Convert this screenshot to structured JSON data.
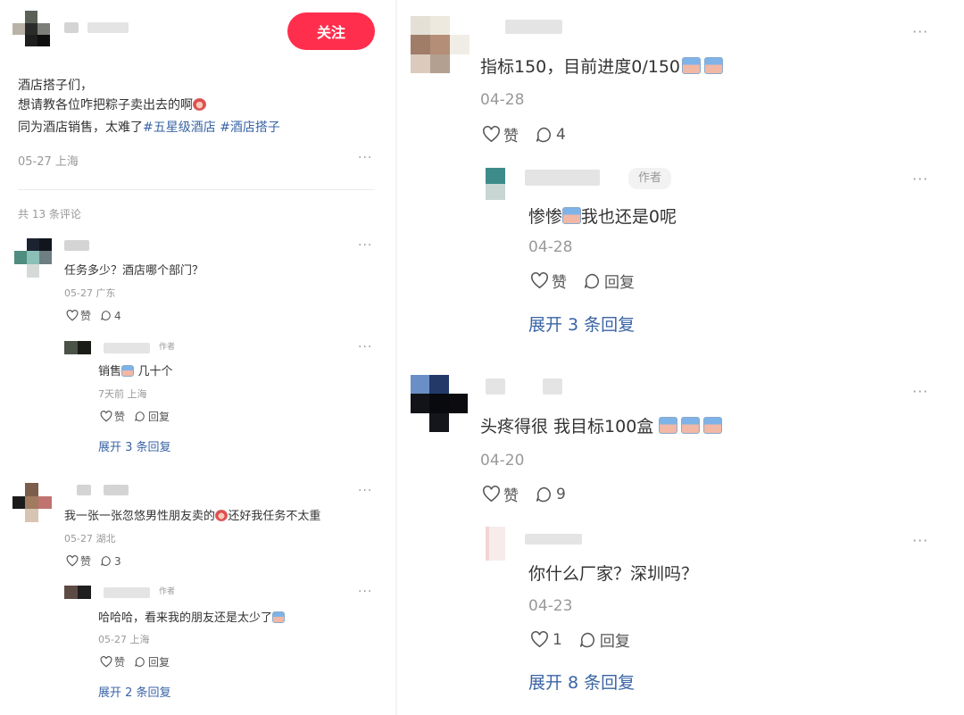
{
  "post": {
    "follow_label": "关注",
    "line1": "酒店搭子们，",
    "line2": "想请教各位咋把粽子卖出去的啊",
    "line3": "同为酒店销售，太难了",
    "tag1": "#五星级酒店",
    "tag2": "#酒店搭子",
    "meta": "05-27 上海",
    "more": "···"
  },
  "left": {
    "comment_count": "共 13 条评论",
    "c1": {
      "text": "任务多少？酒店哪个部门？",
      "meta": "05-27 广东",
      "like": "赞",
      "reply_count": "4"
    },
    "r1": {
      "badge": "作者",
      "text_a": "销售",
      "text_b": " 几十个",
      "meta": "7天前 上海",
      "like": "赞",
      "reply": "回复"
    },
    "expand1": "展开 3 条回复",
    "c2": {
      "text_a": "我一张一张忽悠男性朋友卖的",
      "text_b": "还好我任务不太重",
      "meta": "05-27 湖北",
      "like": "赞",
      "reply_count": "3"
    },
    "r2": {
      "badge": "作者",
      "text": "哈哈哈，看来我的朋友还是太少了",
      "meta": "05-27 上海",
      "like": "赞",
      "reply": "回复"
    },
    "expand2": "展开 2 条回复",
    "more": "···"
  },
  "right": {
    "c1": {
      "text": "指标150，目前进度0/150",
      "meta": "04-28",
      "like": "赞",
      "reply_count": "4"
    },
    "r1": {
      "badge": "作者",
      "text_a": "惨惨",
      "text_b": "我也还是0呢",
      "meta": "04-28",
      "like": "赞",
      "reply": "回复"
    },
    "expand1": "展开 3 条回复",
    "c2": {
      "text": "头疼得很 我目标100盒",
      "meta": "04-20",
      "like": "赞",
      "reply_count": "9"
    },
    "r2": {
      "text": "你什么厂家？深圳吗？",
      "meta": "04-23",
      "like_count": "1",
      "reply": "回复"
    },
    "expand2": "展开 8 条回复",
    "more": "···"
  },
  "colors": {
    "accent": "#ff2e4d",
    "link": "#3a64a5",
    "meta": "#999999"
  },
  "icons": [
    "heart-icon",
    "comment-bubble-icon",
    "more-dots-icon"
  ]
}
